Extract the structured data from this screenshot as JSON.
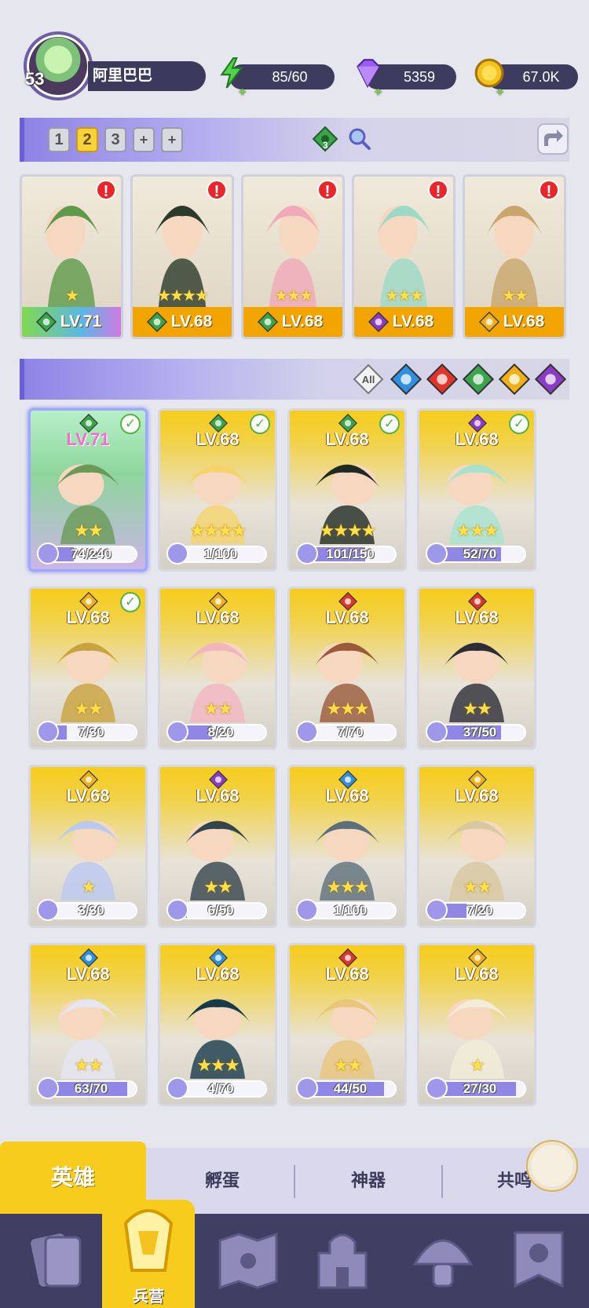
{
  "player": {
    "level": "53",
    "name": "阿里巴巴"
  },
  "resources": {
    "energy": "85/60",
    "gems": "5359",
    "coins": "67.0K"
  },
  "team_bar": {
    "slots": [
      "1",
      "2",
      "3",
      "+",
      "+"
    ],
    "active_slot": "2",
    "element_count": "3"
  },
  "team": [
    {
      "level": "LV.71",
      "element": "wind",
      "stars": "★",
      "alert": "!"
    },
    {
      "level": "LV.68",
      "element": "wind",
      "stars": "★★★★",
      "alert": "!"
    },
    {
      "level": "LV.68",
      "element": "wind",
      "stars": "★★★",
      "alert": "!"
    },
    {
      "level": "LV.68",
      "element": "dark",
      "stars": "★★★",
      "alert": "!"
    },
    {
      "level": "LV.68",
      "element": "light",
      "stars": "★★",
      "alert": "!"
    }
  ],
  "filters": {
    "all_label": "All",
    "elements": [
      "water",
      "fire",
      "wind",
      "light",
      "dark"
    ]
  },
  "heroes": [
    {
      "level": "LV.71",
      "element": "wind",
      "fragments": "74/240",
      "progress": 0.31,
      "stars": "★★",
      "checked": true
    },
    {
      "level": "LV.68",
      "element": "wind",
      "fragments": "1/100",
      "progress": 0.01,
      "stars": "★★★★",
      "checked": true
    },
    {
      "level": "LV.68",
      "element": "wind",
      "fragments": "101/150",
      "progress": 0.67,
      "stars": "★★★★",
      "checked": true
    },
    {
      "level": "LV.68",
      "element": "dark",
      "fragments": "52/70",
      "progress": 0.74,
      "stars": "★★★",
      "checked": true
    },
    {
      "level": "LV.68",
      "element": "light",
      "fragments": "7/30",
      "progress": 0.23,
      "stars": "★★",
      "checked": true
    },
    {
      "level": "LV.68",
      "element": "light",
      "fragments": "8/20",
      "progress": 0.4,
      "stars": "★★",
      "checked": false
    },
    {
      "level": "LV.68",
      "element": "fire",
      "fragments": "7/70",
      "progress": 0.1,
      "stars": "★★★",
      "checked": false
    },
    {
      "level": "LV.68",
      "element": "fire",
      "fragments": "37/50",
      "progress": 0.74,
      "stars": "★★",
      "checked": false
    },
    {
      "level": "LV.68",
      "element": "light",
      "fragments": "3/30",
      "progress": 0.1,
      "stars": "★",
      "checked": false
    },
    {
      "level": "LV.68",
      "element": "dark",
      "fragments": "6/50",
      "progress": 0.12,
      "stars": "★★",
      "checked": false
    },
    {
      "level": "LV.68",
      "element": "water",
      "fragments": "1/100",
      "progress": 0.01,
      "stars": "★★★",
      "checked": false
    },
    {
      "level": "LV.68",
      "element": "light",
      "fragments": "7/20",
      "progress": 0.35,
      "stars": "★★",
      "checked": false
    },
    {
      "level": "LV.68",
      "element": "water",
      "fragments": "63/70",
      "progress": 0.9,
      "stars": "★★",
      "checked": false
    },
    {
      "level": "LV.68",
      "element": "water",
      "fragments": "4/70",
      "progress": 0.06,
      "stars": "★★★",
      "checked": false
    },
    {
      "level": "LV.68",
      "element": "fire",
      "fragments": "44/50",
      "progress": 0.88,
      "stars": "★★",
      "checked": false
    },
    {
      "level": "LV.68",
      "element": "light",
      "fragments": "27/30",
      "progress": 0.9,
      "stars": "★",
      "checked": false
    }
  ],
  "tabs": [
    "英雄",
    "孵蛋",
    "神器",
    "共鸣"
  ],
  "nav": {
    "active_label": "兵营",
    "items": [
      "cards-icon",
      "barracks-icon",
      "map-icon",
      "castle-icon",
      "mushroom-icon",
      "banner-icon"
    ]
  },
  "colors": {
    "gold": "#f8cc1d",
    "purple": "#6a5fd8",
    "wind": "#3aa54b",
    "water": "#2f8fe0",
    "fire": "#e0352a",
    "light": "#f0b018",
    "dark": "#8b3cc7"
  }
}
